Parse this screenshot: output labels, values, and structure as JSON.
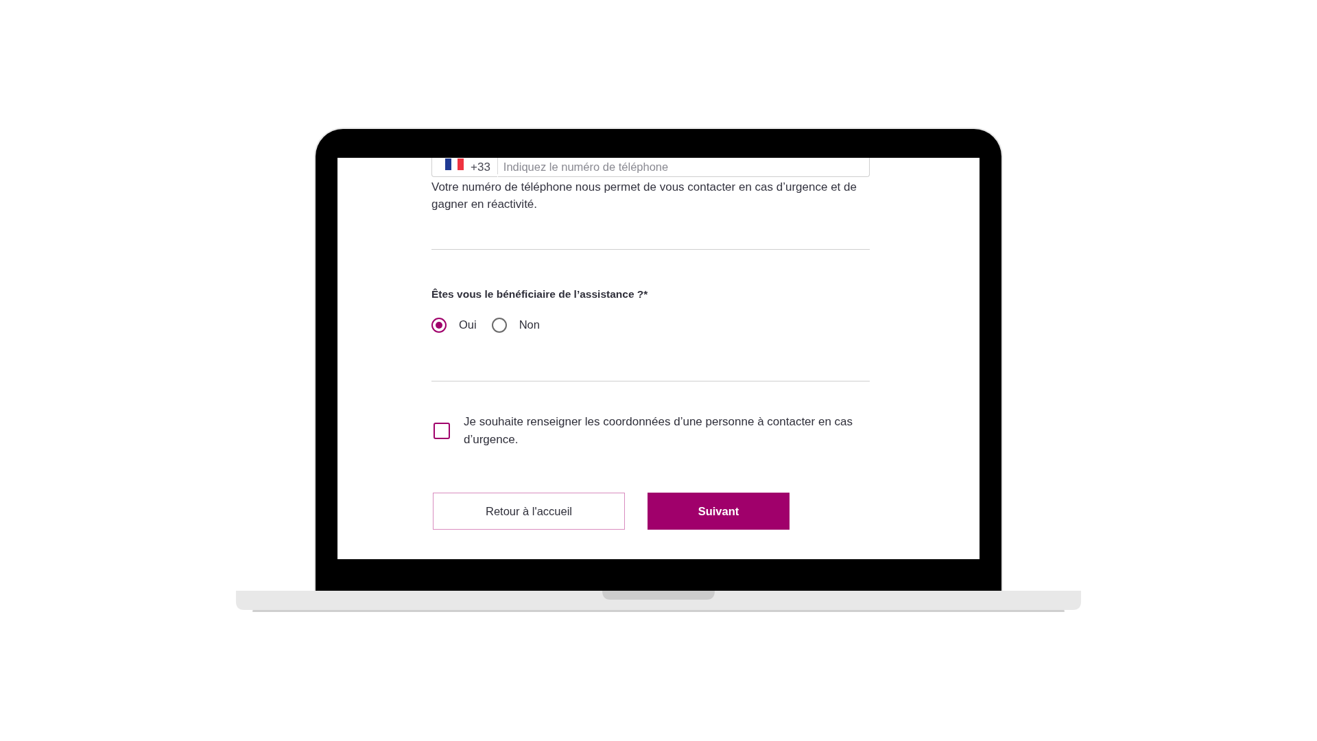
{
  "phone_field": {
    "country_code": "+33",
    "placeholder": "Indiquez le numéro de téléphone",
    "help_text": "Votre numéro de téléphone nous permet de vous contacter en cas d’urgence et de gagner en réactivité."
  },
  "question": {
    "label": "Êtes vous le bénéficiaire de l’assistance ?*",
    "options": [
      {
        "label": "Oui",
        "selected": true
      },
      {
        "label": "Non",
        "selected": false
      }
    ]
  },
  "emergency_contact": {
    "label": "Je souhaite renseigner les coordonnées d’une personne à contacter en cas d’urgence.",
    "checked": false
  },
  "buttons": [
    {
      "label": "Retour à l'accueil",
      "kind": "secondary"
    },
    {
      "label": "Suivant",
      "kind": "primary"
    }
  ]
}
